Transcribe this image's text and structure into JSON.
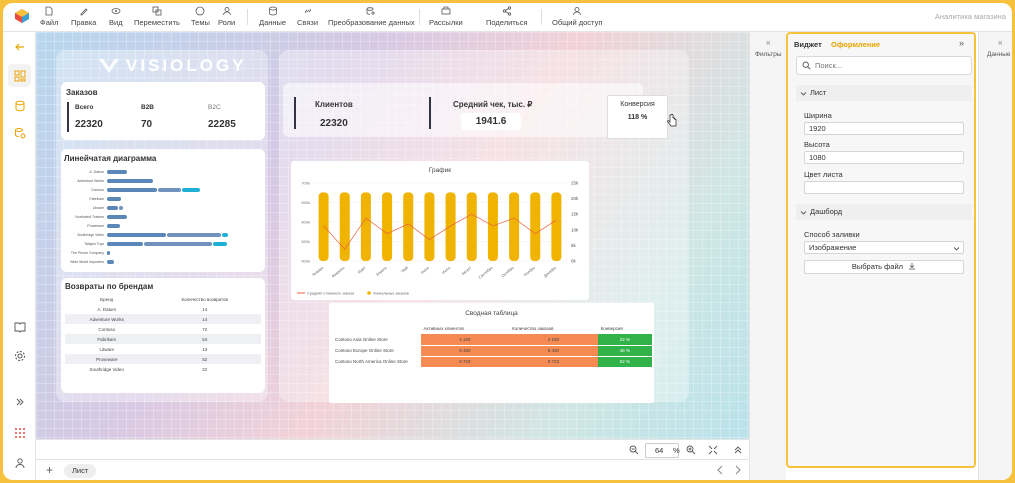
{
  "toolbar": {
    "file": "Файл",
    "edit": "Правка",
    "view": "Вид",
    "move": "Переместить",
    "themes": "Темы",
    "roles": "Роли",
    "data": "Данные",
    "links": "Связи",
    "transform": "Преобразование данных",
    "mailing": "Рассылки",
    "share": "Поделиться",
    "public_access": "Общий доступ",
    "dashboard_title": "Аналитика магазина"
  },
  "canvas": {
    "brand_logo": "VISIOLOGY",
    "orders": {
      "title": "Заказов",
      "total_label": "Всего",
      "total_value": "22320",
      "b2b_label": "B2B",
      "b2b_value": "70",
      "b2c_label": "B2C",
      "b2c_value": "22285"
    },
    "linear_chart": {
      "title": "Линейчатая диаграмма",
      "rows": [
        {
          "label": "A. Datum",
          "bars": [
            0.14,
            0,
            0
          ]
        },
        {
          "label": "Adventure Works",
          "bars": [
            0.33,
            0,
            0
          ]
        },
        {
          "label": "Contoso",
          "bars": [
            0.36,
            0.16,
            0.13
          ]
        },
        {
          "label": "Fabrikam",
          "bars": [
            0.1,
            0,
            0
          ]
        },
        {
          "label": "Litware",
          "bars": [
            0.08,
            0.03,
            0
          ]
        },
        {
          "label": "Northwind Traders",
          "bars": [
            0.14,
            0,
            0
          ]
        },
        {
          "label": "Proseware",
          "bars": [
            0.09,
            0,
            0
          ]
        },
        {
          "label": "Southridge Video",
          "bars": [
            0.42,
            0.39,
            0.04
          ]
        },
        {
          "label": "Tailspin Toys",
          "bars": [
            0.26,
            0.48,
            0.1
          ]
        },
        {
          "label": "The Phone Company",
          "bars": [
            0.02,
            0,
            0
          ]
        },
        {
          "label": "Wide World Importers",
          "bars": [
            0.05,
            0,
            0
          ]
        }
      ]
    },
    "returns": {
      "title": "Возвраты по брендам",
      "col_brand": "Бренд",
      "col_count": "Количество возвратов",
      "rows": [
        {
          "brand": "A. Datum",
          "count": "14"
        },
        {
          "brand": "Adventure Works",
          "count": "14"
        },
        {
          "brand": "Contoso",
          "count": "72"
        },
        {
          "brand": "Fabrikam",
          "count": "54"
        },
        {
          "brand": "Litware",
          "count": "13"
        },
        {
          "brand": "Proseware",
          "count": "52"
        },
        {
          "brand": "Southridge Video",
          "count": "22"
        }
      ]
    },
    "clients": {
      "label": "Клиентов",
      "value": "22320"
    },
    "avg_check": {
      "label": "Средний чек, тыс. ₽",
      "value": "1941.6"
    },
    "conversion": {
      "label": "Конверсия",
      "value": "118 %"
    },
    "pivot": {
      "title": "Сводная таблица",
      "headers": [
        "Активных клиентов",
        "Количество заказов",
        "Конверсия"
      ],
      "rows": [
        {
          "name": "Contoso Asia Online Store",
          "a": "4 159",
          "b": "4 159",
          "c": "22 %"
        },
        {
          "name": "Contoso Europe Online Store",
          "a": "8 450",
          "b": "8 430",
          "c": "46 %"
        },
        {
          "name": "Contoso North America Online Store",
          "a": "9 723",
          "b": "9 723",
          "c": "52 %"
        }
      ]
    }
  },
  "chart_data": {
    "type": "bar",
    "title": "График",
    "categories": [
      "Январь",
      "Февраль",
      "Март",
      "Апрель",
      "Май",
      "Июнь",
      "Июль",
      "Август",
      "Сентябрь",
      "Октябрь",
      "Ноябрь",
      "Декабрь"
    ],
    "series": [
      {
        "name": "Уникальных заказов",
        "type": "bar",
        "axis": "right",
        "values": [
          22,
          22,
          22,
          22,
          22,
          22,
          22,
          22,
          22,
          22,
          22,
          22
        ]
      },
      {
        "name": "Средняя стоимость заказа",
        "type": "line",
        "axis": "left",
        "values": [
          590,
          530,
          610,
          570,
          595,
          555,
          590,
          620,
          590,
          610,
          570,
          605
        ]
      }
    ],
    "y_left_ticks": [
      "500k",
      "550k",
      "600k",
      "650k",
      "700k"
    ],
    "y_right_ticks": [
      "0k",
      "5k",
      "10k",
      "15k",
      "20k",
      "25k"
    ],
    "ylim_left": [
      500,
      700
    ],
    "ylim_right": [
      0,
      25
    ],
    "legend": "bottom-left"
  },
  "bottombar": {
    "zoom": "64",
    "zoom_unit": "%"
  },
  "sheets": {
    "active": "Лист"
  },
  "filters_label": "Фильтры",
  "data_label": "Данные",
  "widget_panel": {
    "tab_widget": "Виджет",
    "tab_design": "Оформление",
    "search_placeholder": "Поиск...",
    "section_sheet": "Лист",
    "width_label": "Ширина",
    "width_value": "1920",
    "height_label": "Высота",
    "height_value": "1080",
    "color_label": "Цвет листа",
    "section_dashboard": "Дашборд",
    "fill_label": "Способ заливки",
    "fill_value": "Изображение",
    "choose_file": "Выбрать файл",
    "accent": "#e8a400"
  }
}
